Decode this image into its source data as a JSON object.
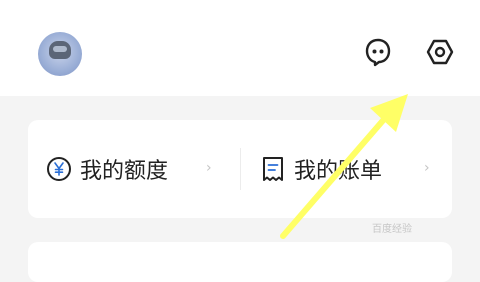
{
  "colors": {
    "background": "#f4f4f4",
    "accent": "#ffff66",
    "icon": "#222222"
  },
  "header": {
    "avatar_badge": "",
    "icons": [
      "chat-bubble-icon",
      "settings-gear-icon"
    ]
  },
  "card": {
    "items": [
      {
        "icon": "yen-circle-icon",
        "label": "我的额度"
      },
      {
        "icon": "receipt-icon",
        "label": "我的账单"
      }
    ]
  },
  "annotation": {
    "icon": "arrow-icon"
  },
  "watermark": "百度经验"
}
